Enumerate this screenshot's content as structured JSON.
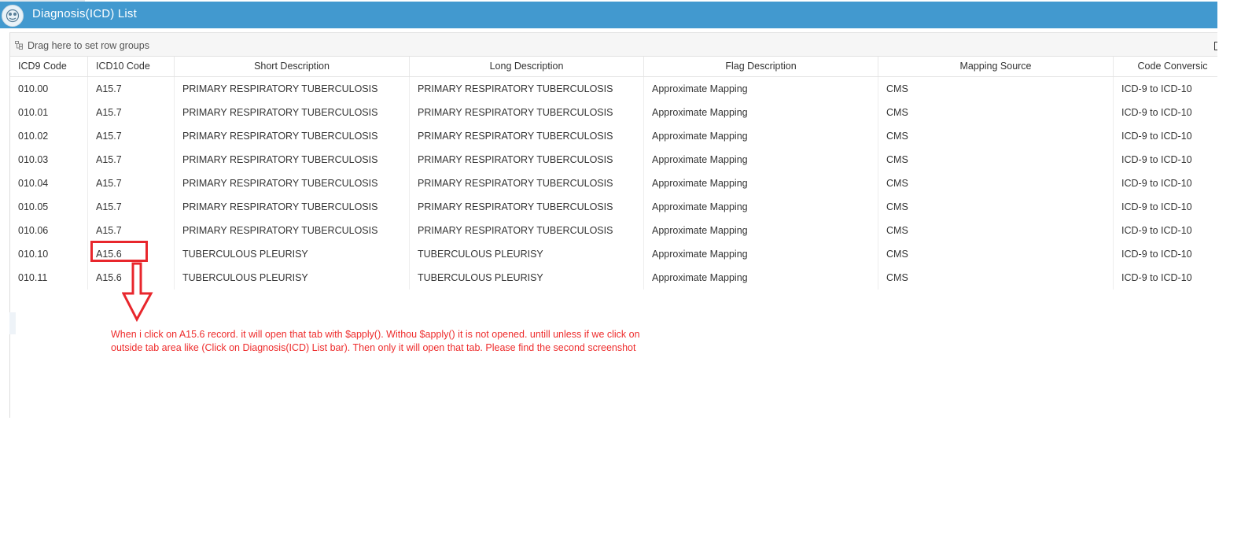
{
  "window": {
    "title": "Diagnosis(ICD) List"
  },
  "group_panel": {
    "text": "Drag here to set row groups"
  },
  "table": {
    "columns": [
      "ICD9 Code",
      "ICD10 Code",
      "Short Description",
      "Long Description",
      "Flag Description",
      "Mapping Source",
      "Code Conversic"
    ],
    "rows": [
      [
        "010.00",
        "A15.7",
        "PRIMARY RESPIRATORY TUBERCULOSIS",
        "PRIMARY RESPIRATORY TUBERCULOSIS",
        "Approximate Mapping",
        "CMS",
        "ICD-9 to ICD-10"
      ],
      [
        "010.01",
        "A15.7",
        "PRIMARY RESPIRATORY TUBERCULOSIS",
        "PRIMARY RESPIRATORY TUBERCULOSIS",
        "Approximate Mapping",
        "CMS",
        "ICD-9 to ICD-10"
      ],
      [
        "010.02",
        "A15.7",
        "PRIMARY RESPIRATORY TUBERCULOSIS",
        "PRIMARY RESPIRATORY TUBERCULOSIS",
        "Approximate Mapping",
        "CMS",
        "ICD-9 to ICD-10"
      ],
      [
        "010.03",
        "A15.7",
        "PRIMARY RESPIRATORY TUBERCULOSIS",
        "PRIMARY RESPIRATORY TUBERCULOSIS",
        "Approximate Mapping",
        "CMS",
        "ICD-9 to ICD-10"
      ],
      [
        "010.04",
        "A15.7",
        "PRIMARY RESPIRATORY TUBERCULOSIS",
        "PRIMARY RESPIRATORY TUBERCULOSIS",
        "Approximate Mapping",
        "CMS",
        "ICD-9 to ICD-10"
      ],
      [
        "010.05",
        "A15.7",
        "PRIMARY RESPIRATORY TUBERCULOSIS",
        "PRIMARY RESPIRATORY TUBERCULOSIS",
        "Approximate Mapping",
        "CMS",
        "ICD-9 to ICD-10"
      ],
      [
        "010.06",
        "A15.7",
        "PRIMARY RESPIRATORY TUBERCULOSIS",
        "PRIMARY RESPIRATORY TUBERCULOSIS",
        "Approximate Mapping",
        "CMS",
        "ICD-9 to ICD-10"
      ],
      [
        "010.10",
        "A15.6",
        "TUBERCULOUS PLEURISY",
        "TUBERCULOUS PLEURISY",
        "Approximate Mapping",
        "CMS",
        "ICD-9 to ICD-10"
      ],
      [
        "010.11",
        "A15.6",
        "TUBERCULOUS PLEURISY",
        "TUBERCULOUS PLEURISY",
        "Approximate Mapping",
        "CMS",
        "ICD-9 to ICD-10"
      ]
    ]
  },
  "annotation": {
    "line1": "When i click on A15.6 record. it will open that tab with $apply(). Withou $apply() it is not opened. untill unless if we click on",
    "line2": "outside tab area like (Click on Diagnosis(ICD) List bar). Then only it will open that tab. Please find the second screenshot",
    "color": "#e8262c"
  },
  "colors": {
    "titlebar": "#4299cf",
    "annotation_text": "#ee2c2c"
  },
  "icons": {
    "logo": "app-logo-icon",
    "group": "row-group-icon",
    "edge": "column-tool-icon"
  }
}
